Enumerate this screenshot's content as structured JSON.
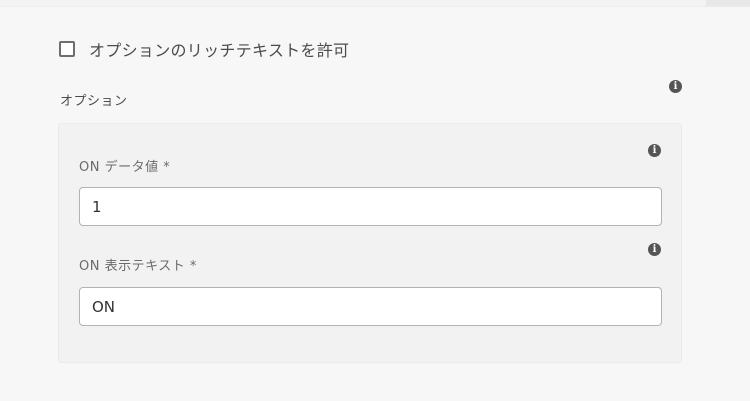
{
  "rich_text": {
    "label": "オプションのリッチテキストを許可",
    "checked": false
  },
  "options": {
    "label": "オプション",
    "info_glyph": "i",
    "fields": [
      {
        "label": "ON データ値 *",
        "value": "1",
        "info_glyph": "i"
      },
      {
        "label": "ON 表示テキスト *",
        "value": "ON",
        "info_glyph": "i"
      }
    ]
  },
  "icons": {
    "checkbox": "checkbox-icon",
    "info": "info-icon"
  },
  "colors": {
    "background": "#f7f7f7",
    "panel": "#f2f2f2",
    "text": "#4b4b4b",
    "icon": "#555555"
  }
}
